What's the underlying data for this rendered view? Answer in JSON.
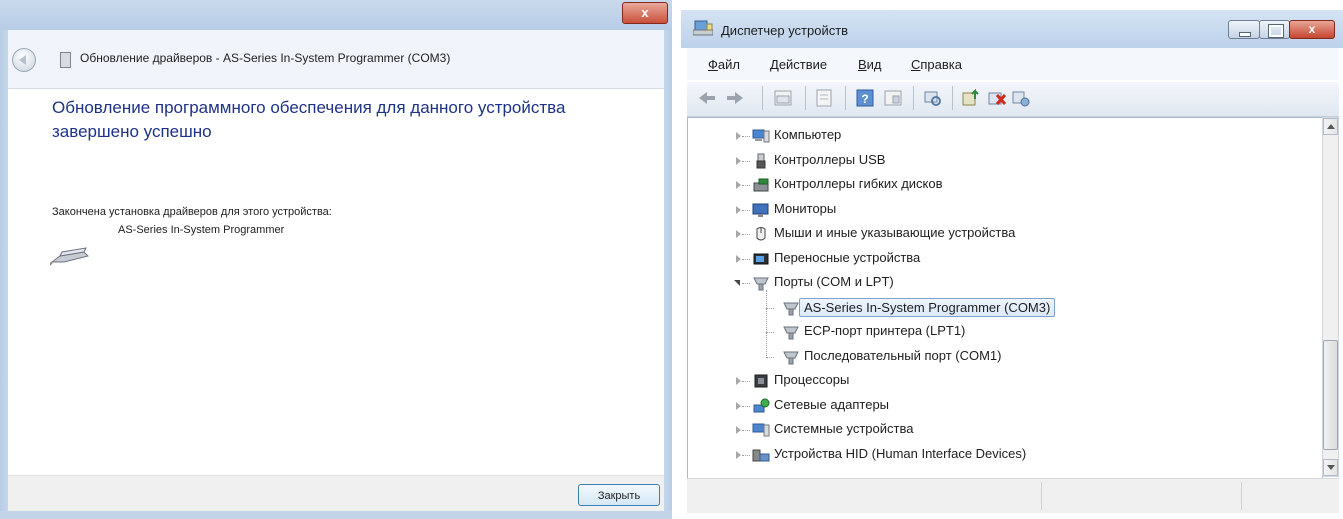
{
  "wizard": {
    "title": "Обновление драйверов - AS-Series In-System Programmer (COM3)",
    "close_glyph": "x",
    "heading": "Обновление программного обеспечения для данного устройства завершено успешно",
    "subtext": "Закончена установка драйверов для этого устройства:",
    "device_name": "AS-Series In-System Programmer",
    "close_button": "Закрыть"
  },
  "device_manager": {
    "title": "Диспетчер устройств",
    "caption_close_glyph": "x",
    "menu": [
      {
        "accel": "Ф",
        "rest": "айл"
      },
      {
        "accel": "Д",
        "rest": "ействие"
      },
      {
        "accel": "В",
        "rest": "ид"
      },
      {
        "accel": "С",
        "rest": "правка"
      }
    ],
    "toolbar_icons": [
      "back-arrow-icon",
      "forward-arrow-icon",
      "properties-grid-icon",
      "document-icon",
      "help-icon",
      "view-icon",
      "scan-hardware-icon",
      "update-driver-icon",
      "disable-device-icon",
      "uninstall-icon"
    ],
    "tree": [
      {
        "label": "Компьютер",
        "icon": "computer-icon"
      },
      {
        "label": "Контроллеры USB",
        "icon": "usb-icon"
      },
      {
        "label": "Контроллеры гибких дисков",
        "icon": "floppy-controller-icon"
      },
      {
        "label": "Мониторы",
        "icon": "monitor-icon"
      },
      {
        "label": "Мыши и иные указывающие устройства",
        "icon": "mouse-icon"
      },
      {
        "label": "Переносные устройства",
        "icon": "portable-device-icon"
      },
      {
        "label": "Порты (COM и LPT)",
        "icon": "port-icon",
        "expanded": true
      },
      {
        "label": "AS-Series In-System Programmer (COM3)",
        "icon": "port-icon",
        "child": true,
        "selected": true
      },
      {
        "label": "ECP-порт принтера (LPT1)",
        "icon": "port-icon",
        "child": true
      },
      {
        "label": "Последовательный порт (COM1)",
        "icon": "port-icon",
        "child": true
      },
      {
        "label": "Процессоры",
        "icon": "processor-icon"
      },
      {
        "label": "Сетевые адаптеры",
        "icon": "network-adapter-icon"
      },
      {
        "label": "Системные устройства",
        "icon": "system-devices-icon"
      },
      {
        "label": "Устройства HID (Human Interface Devices)",
        "icon": "hid-icon"
      }
    ]
  }
}
